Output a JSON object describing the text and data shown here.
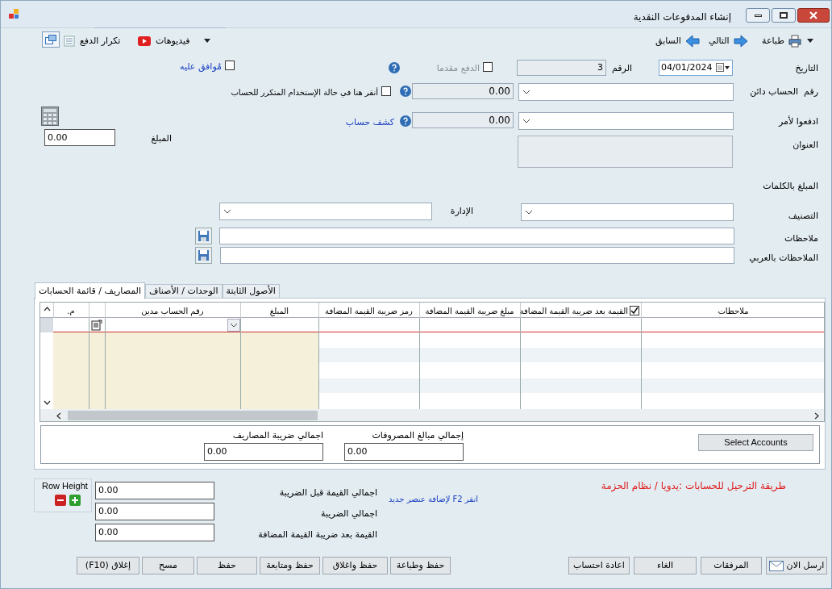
{
  "window": {
    "title": "إنشاء المدفوعات النقدية"
  },
  "toolbar": {
    "left": [
      {
        "label": "فيديوهات"
      },
      {
        "label": "تكرار الدفع"
      }
    ],
    "right": [
      {
        "label": "طباعة"
      },
      {
        "label": "التالي"
      },
      {
        "label": "السابق"
      }
    ]
  },
  "header": {
    "date_label": "التاريخ",
    "date": "04/01/2024",
    "number_label": "الرقم",
    "number": "3",
    "advance_payment": {
      "label": "الدفع مقدما",
      "checked": false,
      "disabled": true
    },
    "approved": {
      "label": "مُوافق عليه",
      "checked": false
    }
  },
  "credit_account": {
    "label": "رقم  الحساب دائن",
    "balance": "0.00",
    "repeat_use": {
      "label": "أنقر هنا في حالة الإستخدام المتكرر للحساب",
      "checked": false
    }
  },
  "pay_to": {
    "label": "ادفعوا لأمر",
    "balance": "0.00",
    "statement_link": "كشف حساب"
  },
  "amount": {
    "label": "المبلغ",
    "value": "0.00"
  },
  "address_label": "العنوان",
  "amount_in_words_label": "المبلغ بالكلمات",
  "classification_label": "التصنيف",
  "department_label": "الإدارة",
  "notes_label": "ملاحظات",
  "arabic_notes_label": "الملاحظات بالعربي",
  "tabs": [
    {
      "label": "الأصول الثابتة",
      "selected": false
    },
    {
      "label": "الوحدات / الأصناف",
      "selected": false
    },
    {
      "label": "المصاريف / قائمة الحسابات",
      "selected": true
    }
  ],
  "table": {
    "columns": [
      "ملاحظات",
      "القيمة بعد ضريبة القيمة المضافة",
      "مبلغ ضريبة القيمة المضافة",
      "رمز ضريبة القيمة المضافة",
      "المبلغ",
      "رقم الحساب مدين",
      ".م"
    ],
    "vat_column_checked": true
  },
  "totals_panel": {
    "button": "Select Accounts",
    "fields": [
      {
        "label": "إجمالي مبالغ المصروفات",
        "value": "0.00"
      },
      {
        "label": "اجمالي ضريبة المصاريف",
        "value": "0.00"
      }
    ]
  },
  "row_height_label": "Row Height",
  "summary": [
    {
      "label": "اجمالي القيمة قبل الضريبة",
      "value": "0.00"
    },
    {
      "label": "اجمالي الضريبة",
      "value": "0.00"
    },
    {
      "label": "القيمة بعد ضريبة القيمة المضافة",
      "value": "0.00"
    }
  ],
  "hint": "انقر F2 لإضافة عنصر جديد",
  "posting_method": "طريقة الترحيل للحسابات :يدويا / نظام الحزمة",
  "buttons_right": [
    "ارسل الان",
    "المرفقات",
    "الغاء",
    "اعادة احتساب"
  ],
  "buttons_left": [
    "حفظ وطباعة",
    "حفظ واغلاق",
    "حفظ ومتابعة",
    "حفظ",
    "مسح",
    "إغلاق (F10)"
  ]
}
